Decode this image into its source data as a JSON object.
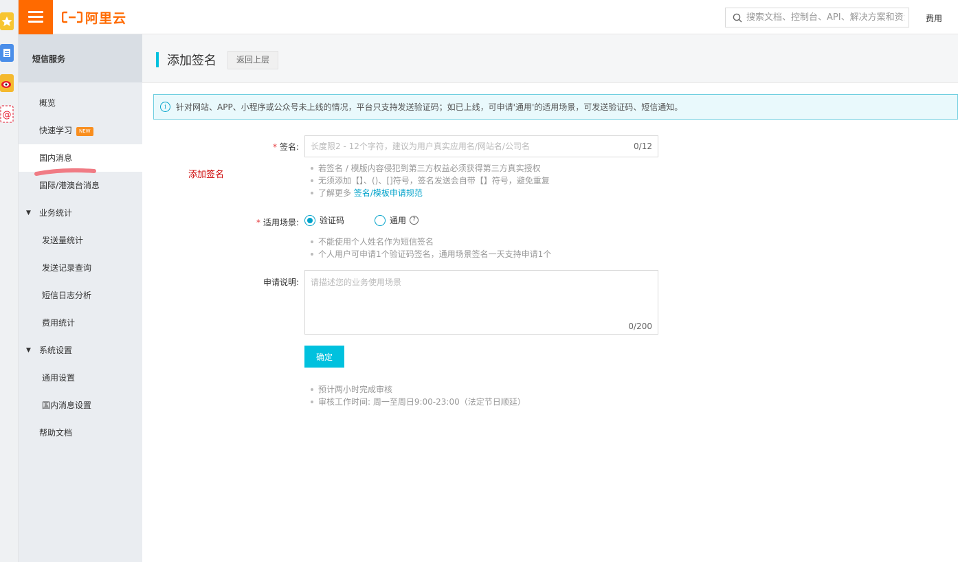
{
  "strip": {
    "icons": [
      "star-icon",
      "document-icon",
      "weibo-icon",
      "email-icon"
    ]
  },
  "topbar": {
    "logo_text": "阿里云",
    "search_placeholder": "搜索文档、控制台、API、解决方案和资源",
    "fee_label": "费用",
    "accent_color": "#ff6a00"
  },
  "sidebar": {
    "title": "短信服务",
    "items": [
      {
        "label": "概览"
      },
      {
        "label": "快速学习",
        "badge": "NEW"
      },
      {
        "label": "国内消息"
      },
      {
        "label": "国际/港澳台消息"
      }
    ],
    "groups": [
      {
        "label": "业务统计",
        "children": [
          "发送量统计",
          "发送记录查询",
          "短信日志分析",
          "费用统计"
        ]
      },
      {
        "label": "系统设置",
        "children": [
          "通用设置",
          "国内消息设置"
        ]
      }
    ],
    "help": "帮助文档"
  },
  "header": {
    "title": "添加签名",
    "back_label": "返回上层"
  },
  "notice": {
    "icon": "info-icon",
    "text": "针对网站、APP、小程序或公众号未上线的情况，平台只支持发送验证码；如已上线，可申请'通用'的适用场景，可发送验证码、短信通知。"
  },
  "annotation": "添加签名",
  "form": {
    "signature": {
      "required_mark": "*",
      "label": "签名:",
      "placeholder": "长度限2 - 12个字符，建议为用户真实应用名/网站名/公司名",
      "counter": "0/12",
      "tips": [
        "若签名 / 模版内容侵犯到第三方权益必须获得第三方真实授权",
        "无须添加【】、()、[]符号，签名发送会自带【】符号，避免重复"
      ],
      "more_prefix": "了解更多",
      "more_link": "签名/模板申请规范"
    },
    "scene": {
      "required_mark": "*",
      "label": "适用场景:",
      "options": [
        "验证码",
        "通用"
      ],
      "selected": "验证码",
      "help_glyph": "?",
      "tips": [
        "不能使用个人姓名作为短信签名",
        "个人用户可申请1个验证码签名，通用场景签名一天支持申请1个"
      ]
    },
    "description": {
      "label": "申请说明:",
      "placeholder": "请描述您的业务使用场景",
      "counter": "0/200"
    },
    "submit_label": "确定",
    "footer_tips": [
      "预计两小时完成审核",
      "审核工作时间: 周一至周日9:00-23:00（法定节日顺延）"
    ]
  }
}
